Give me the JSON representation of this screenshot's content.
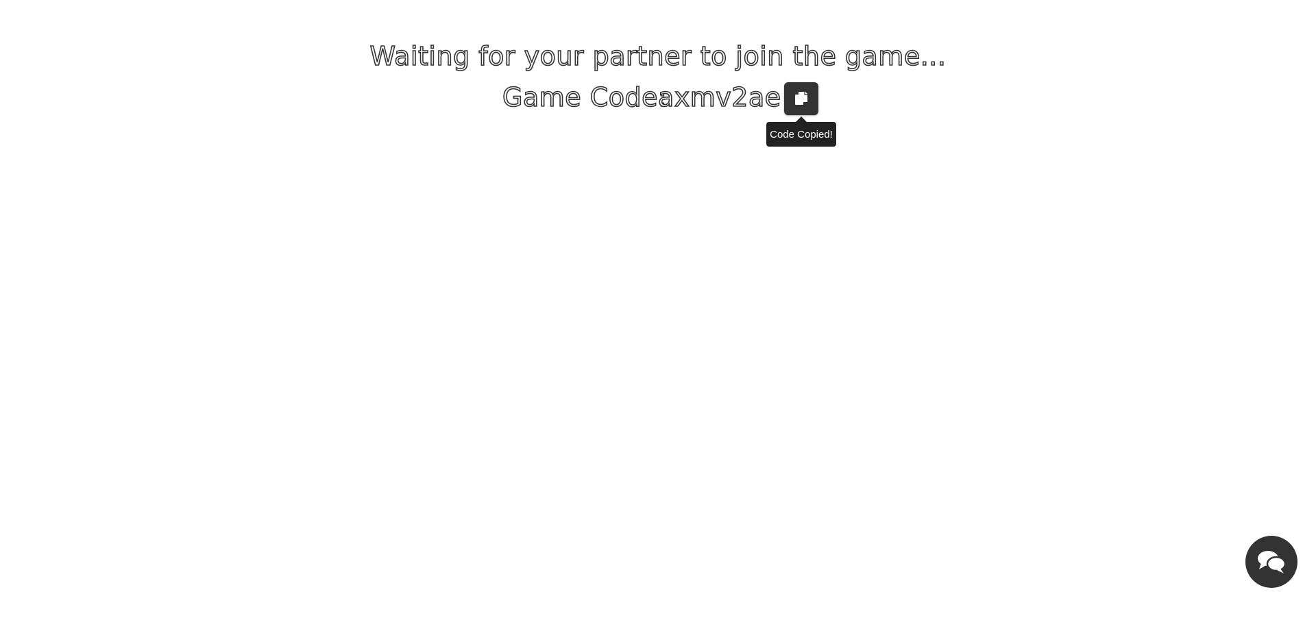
{
  "status": {
    "waiting_text": "Waiting for your partner to join the game..."
  },
  "game_code": {
    "label": "Game Code:",
    "value": "axmv2ae"
  },
  "copy": {
    "icon": "copy-icon",
    "tooltip_text": "Code Copied!"
  },
  "chat": {
    "icon": "chat-bubbles-icon"
  },
  "colors": {
    "button_bg": "#333333",
    "tooltip_bg": "#222222",
    "text_stroke": "#333333",
    "page_bg": "#ffffff"
  }
}
